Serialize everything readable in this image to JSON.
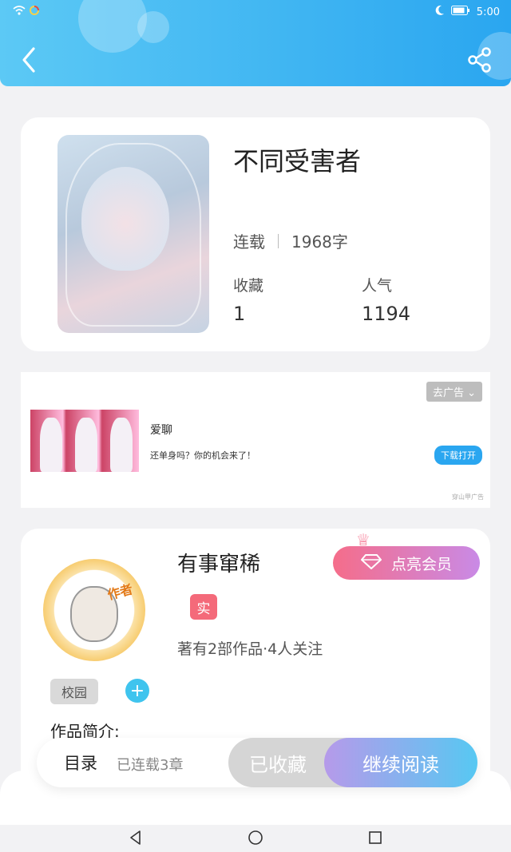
{
  "status_bar": {
    "time": "5:00"
  },
  "book": {
    "title": "不同受害者",
    "status": "连载",
    "word_count": "1968字",
    "favorites_label": "收藏",
    "favorites_value": "1",
    "popularity_label": "人气",
    "popularity_value": "1194"
  },
  "ad": {
    "remove_label": "去广告",
    "title": "爱聊",
    "description": "还单身吗？你的机会来了！",
    "button": "下载打开",
    "footer": "穿山甲广告"
  },
  "author": {
    "badge": "作者",
    "name": "有事窜稀",
    "vip_button": "点亮会员",
    "verified_tag": "实",
    "works_info": "著有2部作品·4人关注",
    "genre_tag": "校园",
    "intro_label": "作品简介:"
  },
  "bottom_bar": {
    "menu_label": "目录",
    "chapters_label": "已连载3章",
    "collected_label": "已收藏",
    "read_label": "继续阅读"
  },
  "colors": {
    "header": "#2aa6f0",
    "accent": "#3fc4ee",
    "vip": "#f56d8a"
  }
}
